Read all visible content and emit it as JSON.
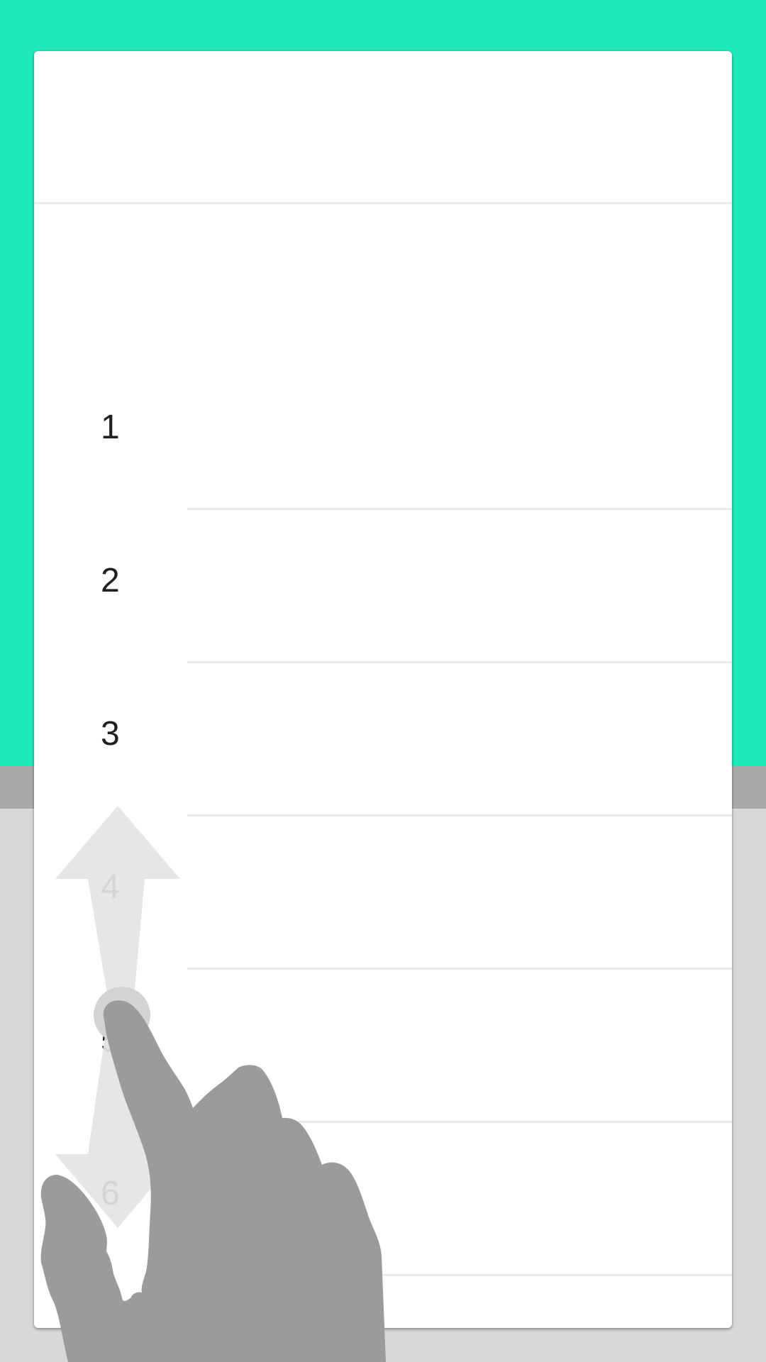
{
  "colors": {
    "accent": "#1eeab8",
    "card": "#ffffff",
    "background": "#d8d8d8",
    "hand": "#9b9b9b",
    "arrow": "#e4e4e4"
  },
  "list": {
    "items": [
      {
        "label": "1"
      },
      {
        "label": "2"
      },
      {
        "label": "3"
      },
      {
        "label": "4"
      },
      {
        "label": "5"
      },
      {
        "label": "6"
      }
    ]
  },
  "gesture": {
    "icon": "hand-pointer-icon",
    "direction_icon": "vertical-double-arrow-icon"
  }
}
